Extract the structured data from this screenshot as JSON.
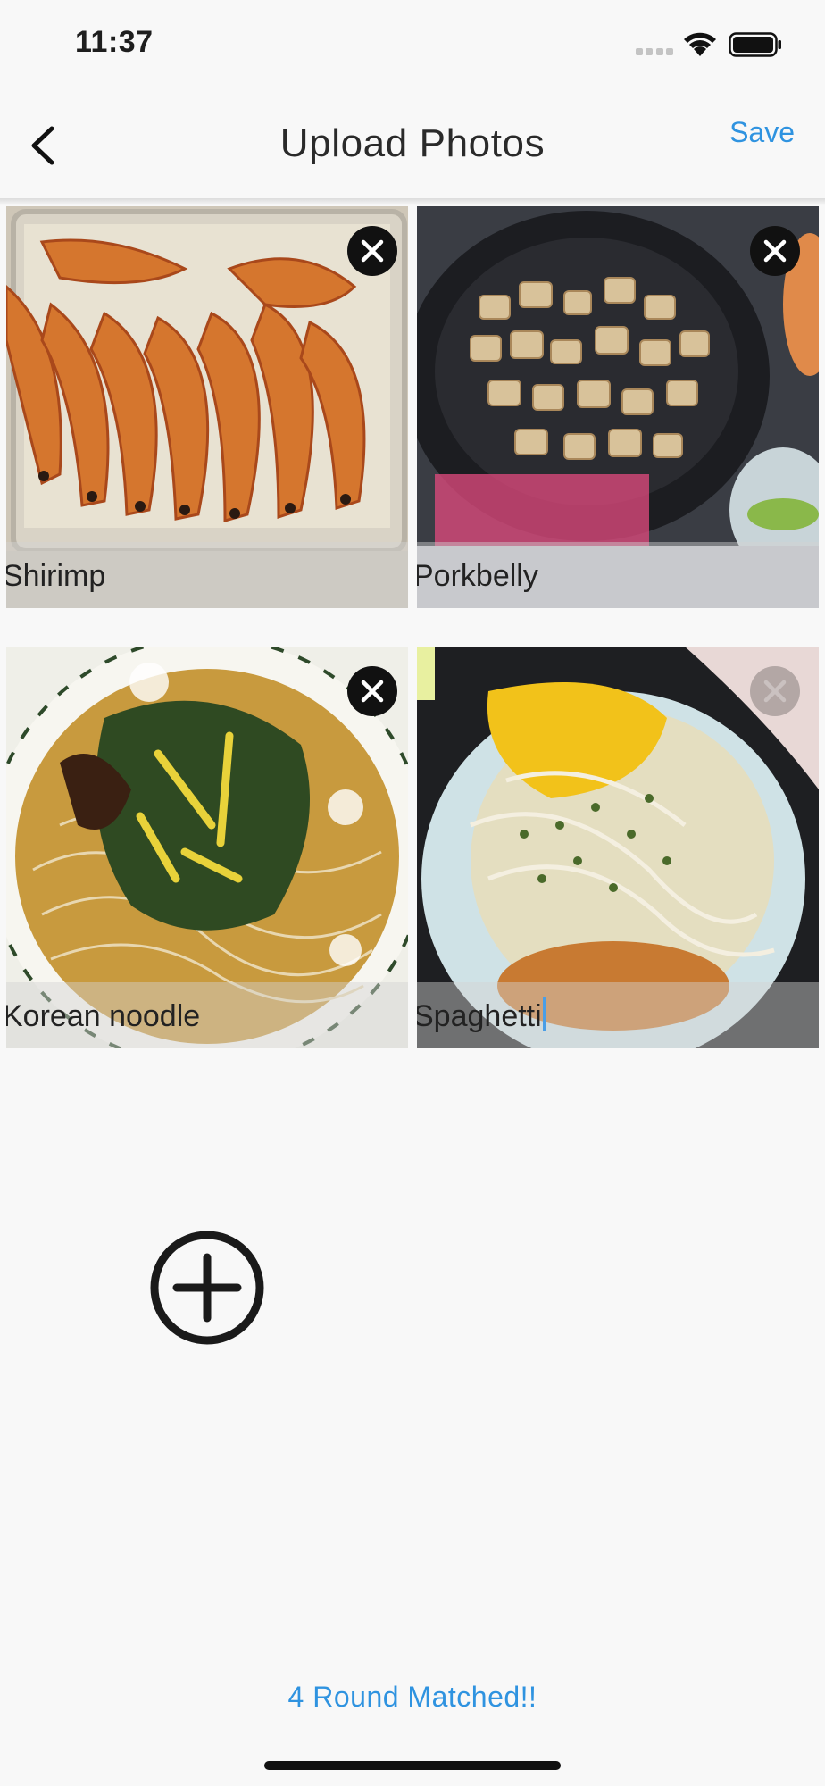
{
  "status": {
    "time": "11:37"
  },
  "nav": {
    "title": "Upload Photos",
    "save_label": "Save"
  },
  "photos": [
    {
      "caption": "Shirimp",
      "subject": "grilled shrimp"
    },
    {
      "caption": "Porkbelly",
      "subject": "pork belly in pan"
    },
    {
      "caption": "Korean noodle",
      "subject": "cold noodle soup"
    },
    {
      "caption": "Spaghetti",
      "subject": "cream spaghetti"
    }
  ],
  "footer": {
    "match_text": "4 Round Matched!!"
  },
  "colors": {
    "accent": "#2f93e0",
    "background": "#f8f8f8"
  }
}
